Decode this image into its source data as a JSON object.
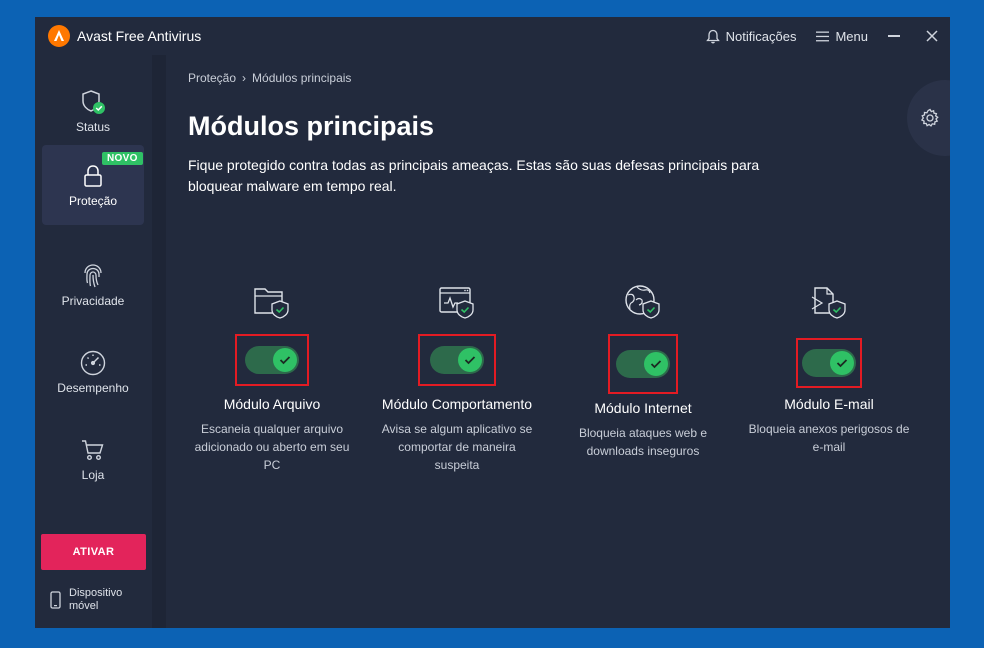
{
  "app": {
    "title": "Avast Free Antivirus"
  },
  "titlebar": {
    "notifications_label": "Notificações",
    "menu_label": "Menu"
  },
  "sidebar": {
    "items": [
      {
        "label": "Status"
      },
      {
        "label": "Proteção",
        "badge": "NOVO"
      },
      {
        "label": "Privacidade"
      },
      {
        "label": "Desempenho"
      },
      {
        "label": "Loja"
      }
    ],
    "activate_label": "ATIVAR",
    "mobile_label_line1": "Dispositivo",
    "mobile_label_line2": "móvel"
  },
  "breadcrumb": {
    "parent": "Proteção",
    "separator": "›",
    "current": "Módulos principais"
  },
  "page": {
    "title": "Módulos principais",
    "description": "Fique protegido contra todas as principais ameaças. Estas são suas defesas principais para bloquear malware em tempo real."
  },
  "modules": [
    {
      "name": "Módulo Arquivo",
      "desc_lines": [
        "Escaneia qualquer arquivo",
        "adicionado ou aberto em seu",
        "PC"
      ],
      "enabled": true
    },
    {
      "name": "Módulo Comportamento",
      "desc_lines": [
        "Avisa se algum aplicativo se",
        "comportar de maneira",
        "suspeita"
      ],
      "enabled": true
    },
    {
      "name": "Módulo Internet",
      "desc_lines": [
        "Bloqueia ataques web e",
        "downloads inseguros"
      ],
      "enabled": true
    },
    {
      "name": "Módulo E-mail",
      "desc_lines": [
        "Bloqueia anexos perigosos de",
        "e-mail"
      ],
      "enabled": true
    }
  ],
  "colors": {
    "background": "#222a3d",
    "accent_green": "#2fc165",
    "toggle_track": "#2d6a4b",
    "activate_red": "#e3245b",
    "highlight_red": "#e31b23",
    "brand_orange": "#ff7800"
  },
  "icons": {
    "logo": "avast-logo-icon",
    "notifications": "bell-icon",
    "menu": "hamburger-icon",
    "minimize": "minimize-icon",
    "close": "close-icon",
    "settings": "gear-icon"
  }
}
